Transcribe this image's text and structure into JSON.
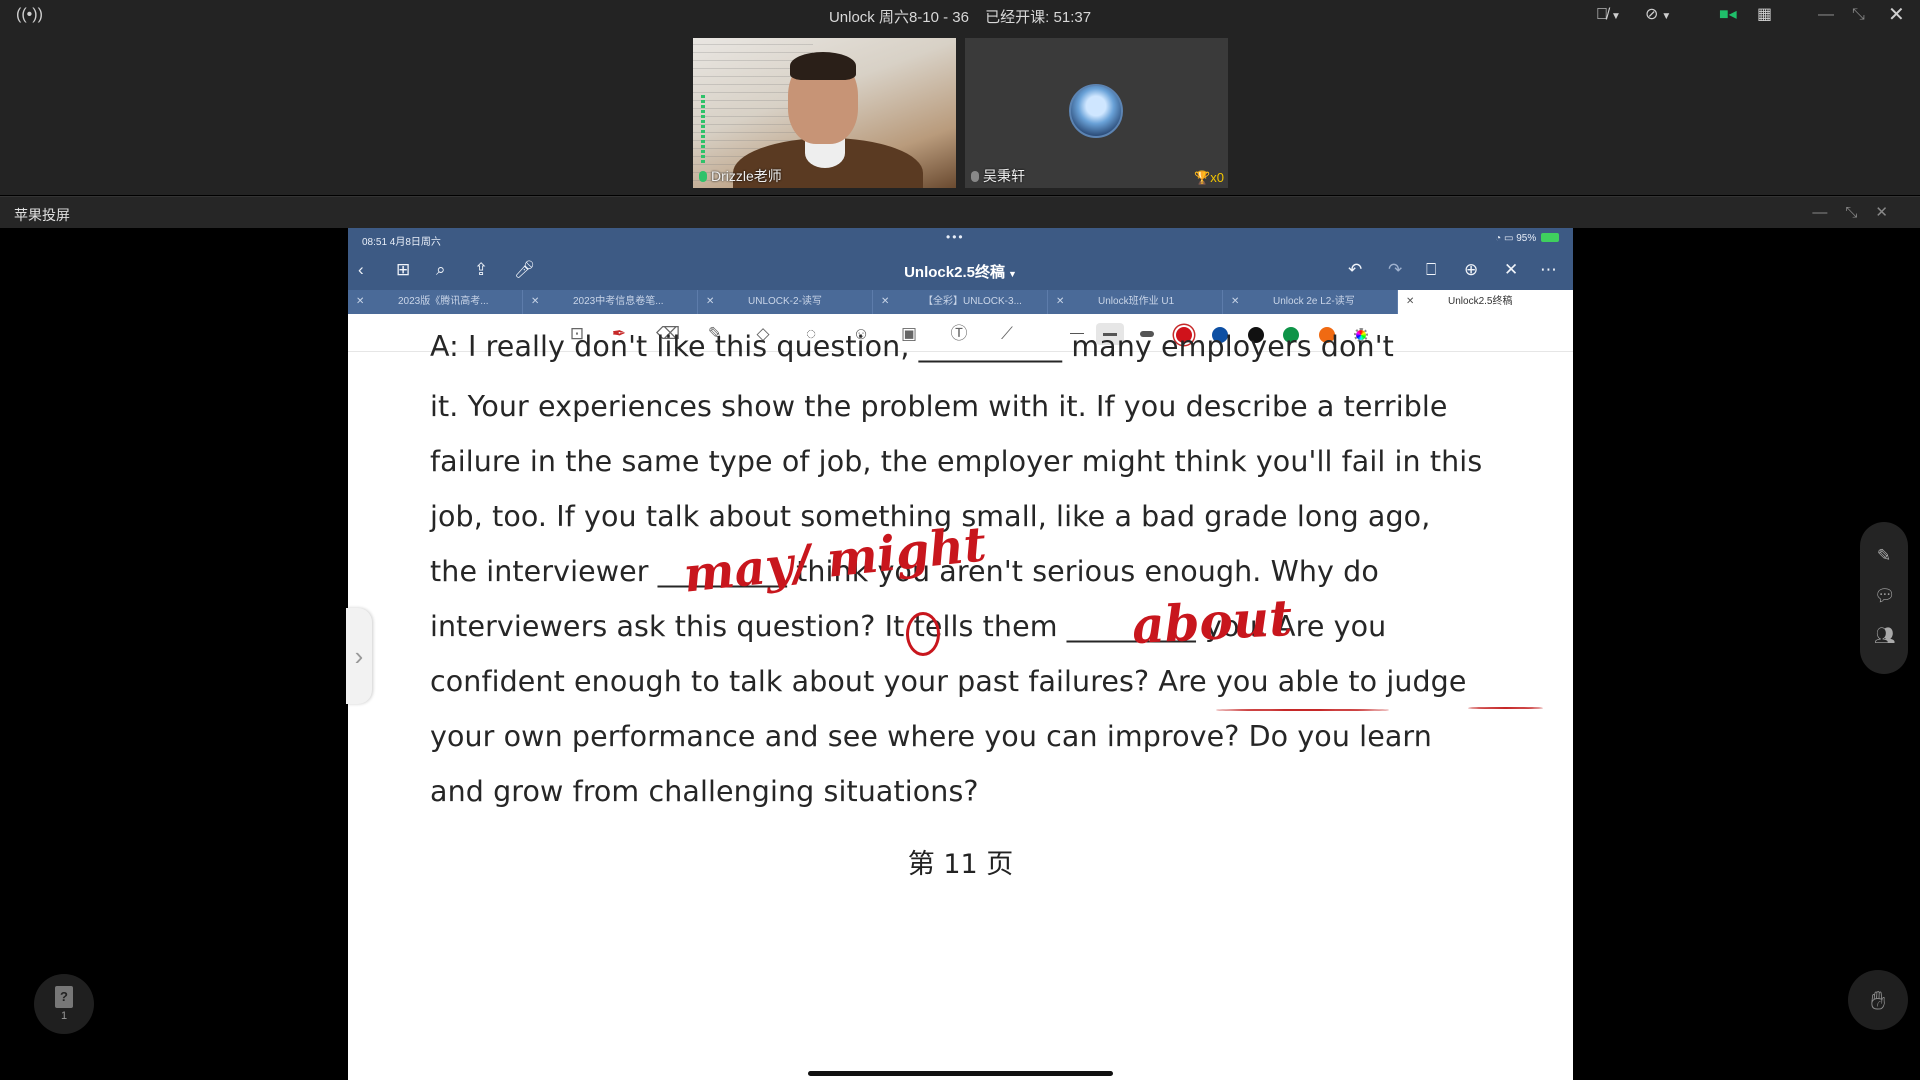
{
  "meeting": {
    "class_name": "Unlock 周六8-10 - 36",
    "elapsed_label": "已经开课: 51:37",
    "broadcast_icon": "broadcast-icon",
    "participants": [
      {
        "name": "Drizzle老师",
        "icon": "mic-on-icon"
      },
      {
        "name": "吴秉轩",
        "icon": "mic-off-icon",
        "trophies": "x0"
      }
    ]
  },
  "share": {
    "label": "苹果投屏"
  },
  "ipad": {
    "status_time": "08:51  4月8日周六",
    "status_right": "95%",
    "doc_title": "Unlock2.5终稿",
    "tabs": [
      {
        "label": "2023版《腾讯高考..."
      },
      {
        "label": "2023中考信息卷笔..."
      },
      {
        "label": "UNLOCK-2-读写"
      },
      {
        "label": "【全彩】UNLOCK-3..."
      },
      {
        "label": "Unlock班作业 U1"
      },
      {
        "label": "Unlock 2e L2-读写"
      },
      {
        "label": "Unlock2.5终稿"
      }
    ],
    "colors": {
      "red": "#d0121b",
      "blue": "#0d4fa3",
      "black": "#111111",
      "green": "#0e9448",
      "orange": "#f06a12"
    }
  },
  "page": {
    "lines": [
      "A: I really don't like this question, __________ many employers don't",
      "it. Your experiences show the problem with it. If you describe a terrible",
      "failure in the same type of job, the employer might think you'll fail in this",
      "job, too. If you talk about something small, like a bad grade long ago,",
      "the  interviewer _________ think you aren't serious enough. Why do",
      "interviewers ask this question? It tells them _________ you.  Are you",
      "confident enough to talk about your past failures? Are you able to judge",
      "your own performance and see where you can improve? Do you learn",
      "and grow from challenging situations?"
    ],
    "page_number": "第 11 页",
    "handwriting": {
      "answer1": "may/ might",
      "answer2": "about"
    }
  },
  "widgets": {
    "page_count": "1"
  }
}
